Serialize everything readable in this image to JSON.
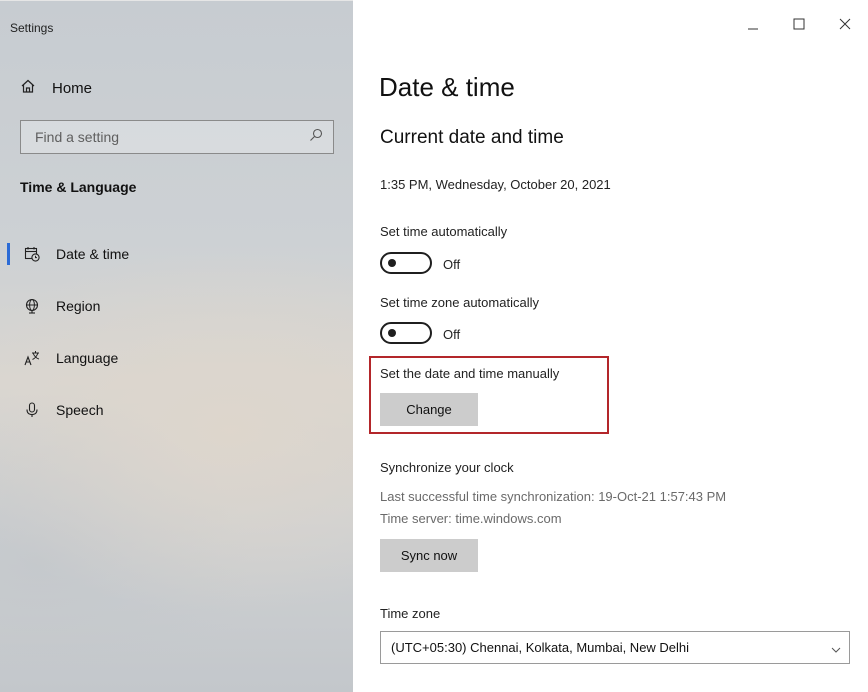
{
  "window": {
    "title": "Settings",
    "minimize_icon": "minimize-icon",
    "maximize_icon": "maximize-icon",
    "close_icon": "close-icon"
  },
  "sidebar": {
    "home_label": "Home",
    "search_placeholder": "Find a setting",
    "section_heading": "Time & Language",
    "items": [
      {
        "label": "Date & time",
        "icon": "calendar-clock-icon",
        "active": true
      },
      {
        "label": "Region",
        "icon": "globe-icon",
        "active": false
      },
      {
        "label": "Language",
        "icon": "language-icon",
        "active": false
      },
      {
        "label": "Speech",
        "icon": "microphone-icon",
        "active": false
      }
    ]
  },
  "main": {
    "page_title": "Date & time",
    "section_title": "Current date and time",
    "current_datetime": "1:35 PM, Wednesday, October 20, 2021",
    "set_time_auto_label": "Set time automatically",
    "set_time_auto_state": "Off",
    "set_tz_auto_label": "Set time zone automatically",
    "set_tz_auto_state": "Off",
    "manual_label": "Set the date and time manually",
    "change_button": "Change",
    "sync_heading": "Synchronize your clock",
    "last_sync": "Last successful time synchronization: 19-Oct-21 1:57:43 PM",
    "time_server": "Time server: time.windows.com",
    "sync_button": "Sync now",
    "timezone_label": "Time zone",
    "timezone_value": "(UTC+05:30) Chennai, Kolkata, Mumbai, New Delhi"
  },
  "colors": {
    "accent": "#2b6bd6",
    "highlight_border": "#b3262a",
    "button_bg": "#cccccc"
  }
}
